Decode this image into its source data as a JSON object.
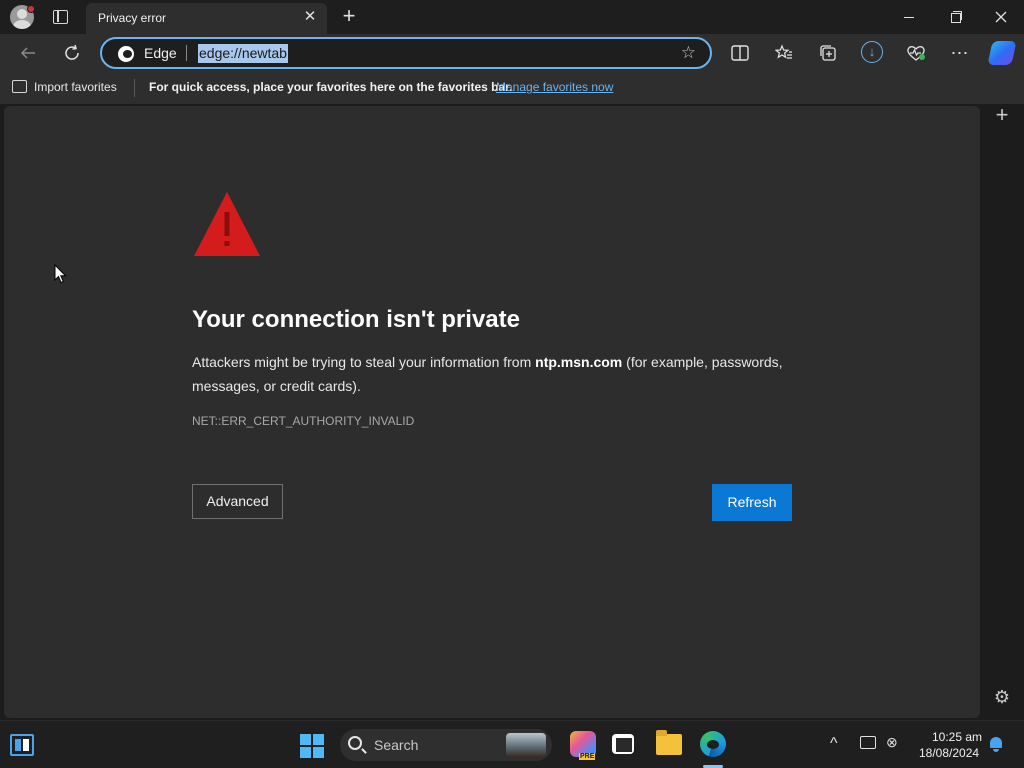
{
  "window": {
    "tab_title": "Privacy error",
    "close_tab_symbol": "✕",
    "new_tab_symbol": "+"
  },
  "toolbar": {
    "site_label": "Edge",
    "url": "edge://newtab"
  },
  "favorites_bar": {
    "import_label": "Import favorites",
    "hint": "For quick access, place your favorites here on the favorites bar.",
    "manage_link": "Manage favorites now"
  },
  "page": {
    "heading": "Your connection isn't private",
    "desc_before": "Attackers might be trying to steal your information from ",
    "desc_host": "ntp.msn.com",
    "desc_after": " (for example, passwords, messages, or credit cards).",
    "error_code": "NET::ERR_CERT_AUTHORITY_INVALID",
    "advanced_label": "Advanced",
    "refresh_label": "Refresh"
  },
  "taskbar": {
    "search_placeholder": "Search",
    "time": "10:25 am",
    "date": "18/08/2024",
    "pre_badge": "PRE"
  },
  "colors": {
    "accent": "#0a78d4",
    "warning_red": "#d41c1c",
    "link": "#6ab4f0"
  },
  "icons": {
    "profile": "profile-icon",
    "tab_actions": "tab-actions-icon",
    "back": "back-arrow-icon",
    "reload": "refresh-icon",
    "favorite": "star-icon",
    "split": "split-screen-icon",
    "favorites": "favorites-icon",
    "collections": "collections-icon",
    "downloads": "download-icon",
    "performance": "heartbeat-icon",
    "more": "more-icon",
    "copilot": "copilot-icon",
    "warning": "warning-triangle-icon"
  }
}
